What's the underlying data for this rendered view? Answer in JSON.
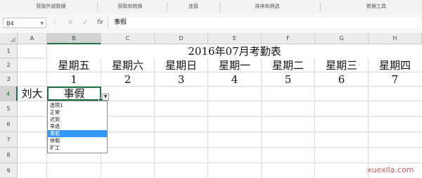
{
  "ribbon": {
    "groups": [
      "获取外部数据",
      "获取和转换",
      "连接",
      "排序和筛选",
      "数据工具"
    ]
  },
  "formula_bar": {
    "name_box": "B4",
    "cancel_icon": "✕",
    "enter_icon": "✓",
    "fx_label": "fx",
    "value": "事假"
  },
  "grid": {
    "columns": [
      "A",
      "B",
      "C",
      "D",
      "E",
      "F",
      "G",
      "H"
    ],
    "rows": [
      "1",
      "2",
      "3",
      "4",
      "5",
      "6",
      "7",
      "8",
      "9"
    ],
    "selected_column": "B",
    "selected_row": "4",
    "title": "2016年07月考勤表",
    "weekdays": [
      "星期五",
      "星期六",
      "星期日",
      "星期一",
      "星期二",
      "星期三",
      "星期四"
    ],
    "dates": [
      "1",
      "2",
      "3",
      "4",
      "5",
      "6",
      "7"
    ],
    "employee_name": "刘大",
    "active_cell_value": "事假"
  },
  "dropdown": {
    "options": [
      "选项1",
      "正常",
      "迟到",
      "早退",
      "事假",
      "休假",
      "旷工"
    ],
    "highlighted": "事假"
  },
  "watermark": "xuexila.com",
  "colors": {
    "accent": "#217346",
    "highlight": "#3399ff"
  }
}
